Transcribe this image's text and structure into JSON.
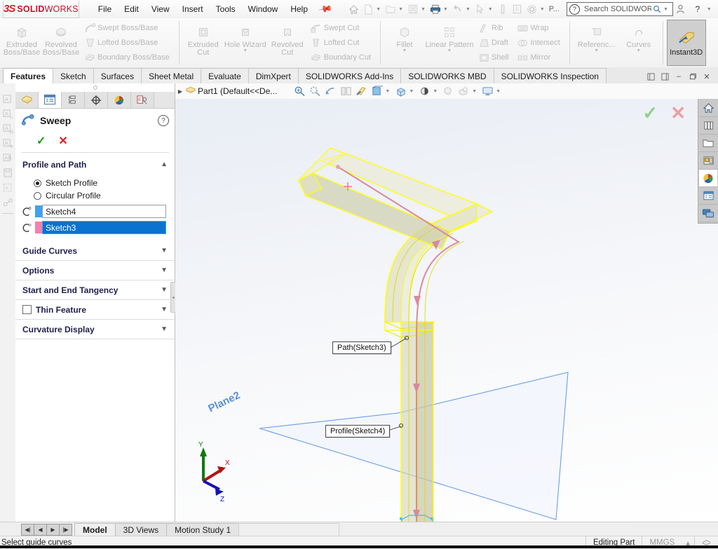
{
  "app": {
    "brand_ds": "ĐS",
    "brand_solid": "SOLID",
    "brand_works": "WORKS",
    "accent_red": "#c8102e",
    "accent_blue": "#0a72cf"
  },
  "menu": {
    "items": [
      "File",
      "Edit",
      "View",
      "Insert",
      "Tools",
      "Window",
      "Help"
    ],
    "pin_icon": "pushpin-icon"
  },
  "quickaccess": {
    "items": [
      {
        "name": "home-icon",
        "glyph": "⌂"
      },
      {
        "name": "new-document-icon",
        "glyph": "⬚"
      },
      {
        "name": "open-document-icon",
        "glyph": "Ὄ2"
      },
      {
        "name": "save-icon",
        "glyph": "Ὃe"
      },
      {
        "name": "print-icon",
        "glyph": "⎙"
      },
      {
        "name": "undo-icon",
        "glyph": "↶"
      },
      {
        "name": "select-icon",
        "glyph": "➤"
      },
      {
        "name": "measure-icon",
        "glyph": "▌"
      },
      {
        "name": "properties-icon",
        "glyph": "☰"
      },
      {
        "name": "options-gear-icon",
        "glyph": "⚙"
      }
    ],
    "overflow_label": "P..."
  },
  "search": {
    "placeholder": "Search SOLIDWORKS Help",
    "value": "Search SOLIDWORKS",
    "help_glyph": "?"
  },
  "window_controls": {
    "account": "὆4",
    "help": "?",
    "minimize": "–",
    "restore": "❐",
    "close": "✕"
  },
  "ribbon": {
    "groups": [
      {
        "name": "boss-base-group",
        "big": [
          {
            "label": "Extruded\nBoss/Base",
            "icon": "extruded-boss-icon"
          },
          {
            "label": "Revolved\nBoss/Base",
            "icon": "revolved-boss-icon"
          }
        ],
        "rows": [
          {
            "label": "Swept Boss/Base",
            "icon": "swept-boss-icon"
          },
          {
            "label": "Lofted Boss/Base",
            "icon": "lofted-boss-icon"
          },
          {
            "label": "Boundary Boss/Base",
            "icon": "boundary-boss-icon"
          }
        ]
      },
      {
        "name": "cut-group",
        "big": [
          {
            "label": "Extruded\nCut",
            "icon": "extruded-cut-icon"
          },
          {
            "label": "Hole Wizard",
            "icon": "hole-wizard-icon"
          },
          {
            "label": "Revolved\nCut",
            "icon": "revolved-cut-icon"
          }
        ],
        "rows": [
          {
            "label": "Swept Cut",
            "icon": "swept-cut-icon"
          },
          {
            "label": "Lofted Cut",
            "icon": "lofted-cut-icon"
          },
          {
            "label": "Boundary Cut",
            "icon": "boundary-cut-icon"
          }
        ]
      },
      {
        "name": "feature-group",
        "big": [
          {
            "label": "Fillet",
            "icon": "fillet-icon"
          },
          {
            "label": "Linear Pattern",
            "icon": "linear-pattern-icon"
          }
        ],
        "rows": [
          {
            "label": "Rib",
            "icon": "rib-icon"
          },
          {
            "label": "Draft",
            "icon": "draft-icon"
          },
          {
            "label": "Shell",
            "icon": "shell-icon"
          }
        ],
        "rows2": [
          {
            "label": "Wrap",
            "icon": "wrap-icon"
          },
          {
            "label": "Intersect",
            "icon": "intersect-icon"
          },
          {
            "label": "Mirror",
            "icon": "mirror-icon"
          }
        ]
      },
      {
        "name": "reference-group",
        "big": [
          {
            "label": "Referenc...",
            "icon": "reference-geometry-icon"
          },
          {
            "label": "Curves",
            "icon": "curves-icon"
          }
        ]
      }
    ],
    "instant3d": {
      "label": "Instant3D",
      "icon": "instant3d-icon",
      "active": true
    }
  },
  "ribbon_tabs": {
    "items": [
      "Features",
      "Sketch",
      "Surfaces",
      "Sheet Metal",
      "Evaluate",
      "DimXpert",
      "SOLIDWORKS Add-Ins",
      "SOLIDWORKS MBD",
      "SOLIDWORKS Inspection"
    ],
    "active": "Features",
    "right_buttons": [
      {
        "name": "collapse-left-icon",
        "glyph": "◧"
      },
      {
        "name": "collapse-right-icon",
        "glyph": "◨"
      },
      {
        "name": "doc-minimize-icon",
        "glyph": "–"
      },
      {
        "name": "doc-restore-icon",
        "glyph": "❐"
      },
      {
        "name": "doc-close-icon",
        "glyph": "✕"
      }
    ]
  },
  "left_strip": {
    "icons": [
      "annotation-note-icon",
      "annotation-balloon-icon",
      "annotation-surface-finish-icon",
      "annotation-weld-icon",
      "annotation-datum-icon",
      "annotation-hole-callout-icon",
      "annotation-block-icon",
      "annotation-centerline-icon"
    ]
  },
  "property_manager": {
    "tabs": [
      {
        "name": "featuremanager-tree-tab",
        "icon": "part-tree-icon",
        "active": false
      },
      {
        "name": "propertymanager-tab",
        "icon": "property-list-icon",
        "active": true
      },
      {
        "name": "configurationmanager-tab",
        "icon": "configuration-icon",
        "active": false
      },
      {
        "name": "dimxpertmanager-tab",
        "icon": "dimxpert-icon",
        "active": false
      },
      {
        "name": "displaymanager-tab",
        "icon": "appearance-ball-icon",
        "active": false
      },
      {
        "name": "addins-tab",
        "icon": "addins-icon",
        "active": false
      }
    ],
    "title": "Sweep",
    "title_icon": "sweep-icon",
    "help_glyph": "?",
    "ok_label": "✓",
    "cancel_label": "✕",
    "sections": {
      "profile_and_path": {
        "label": "Profile and Path",
        "chevron": "⌃",
        "options": [
          {
            "label": "Sketch Profile",
            "selected": true
          },
          {
            "label": "Circular Profile",
            "selected": false
          }
        ],
        "fields": [
          {
            "name": "profile-selection",
            "icon": "profile-icon",
            "swatch": "#3fa2f0",
            "value": "Sketch4",
            "selected": false
          },
          {
            "name": "path-selection",
            "icon": "path-icon",
            "swatch": "#f47fb0",
            "value": "Sketch3",
            "selected": true
          }
        ]
      },
      "collapsed": [
        {
          "label": "Guide Curves",
          "chevron": "⌄",
          "checkbox": false
        },
        {
          "label": "Options",
          "chevron": "⌄",
          "checkbox": false
        },
        {
          "label": "Start and End Tangency",
          "chevron": "⌄",
          "checkbox": false
        },
        {
          "label": "Thin Feature",
          "chevron": "⌄",
          "checkbox": true
        },
        {
          "label": "Curvature Display",
          "chevron": "⌄",
          "checkbox": false
        }
      ]
    }
  },
  "tree_bar": {
    "expand_glyph": "▶",
    "part_icon": "part-icon",
    "label": "Part1  (Default<<De...",
    "view_tools": [
      {
        "name": "zoom-to-fit-icon",
        "glyph": "ὐd"
      },
      {
        "name": "zoom-to-area-icon",
        "glyph": "ὐe"
      },
      {
        "name": "previous-view-icon",
        "glyph": "↩"
      },
      {
        "name": "section-view-icon",
        "glyph": "◫"
      },
      {
        "name": "view-orientation-icon",
        "glyph": "✦"
      },
      {
        "name": "display-style-icon",
        "glyph": "Ὓc",
        "has_dropdown": true
      },
      {
        "name": "hide-show-items-icon",
        "glyph": "⬜",
        "has_dropdown": true
      },
      {
        "name": "edit-appearance-icon",
        "glyph": "◐",
        "has_dropdown": true
      },
      {
        "name": "apply-scene-icon",
        "glyph": "●",
        "has_dropdown": false
      },
      {
        "name": "view-settings-icon",
        "glyph": "☁",
        "has_dropdown": true
      },
      {
        "name": "viewport-icon",
        "glyph": "Ὓ5",
        "has_dropdown": true
      }
    ]
  },
  "graphics": {
    "confirm_ok": "✓",
    "confirm_cancel": "✕",
    "plane_label": "Plane2",
    "callouts": [
      {
        "name": "path-callout",
        "text": "Path(Sketch3)"
      },
      {
        "name": "profile-callout",
        "text": "Profile(Sketch4)"
      }
    ],
    "triad": {
      "x": "X",
      "y": "Y",
      "z": "Z"
    },
    "colors": {
      "preview_yellow": "#ffff00",
      "path_pink": "#e08a9a",
      "plane_blue": "#6b9fe8",
      "plane_fill": "#eaf1fd"
    }
  },
  "task_pane": {
    "items": [
      {
        "name": "task-pane-home-icon",
        "glyph": "⌂",
        "active": false
      },
      {
        "name": "task-pane-design-library-icon",
        "glyph": "Ὅa",
        "active": false
      },
      {
        "name": "task-pane-file-explorer-icon",
        "glyph": "Ὄ1",
        "active": false
      },
      {
        "name": "task-pane-view-palette-icon",
        "glyph": "Ὓc",
        "active": false
      },
      {
        "name": "task-pane-appearances-icon",
        "glyph": "◕",
        "active": true
      },
      {
        "name": "task-pane-custom-properties-icon",
        "glyph": "☰",
        "active": false
      },
      {
        "name": "task-pane-forum-icon",
        "glyph": "὞8",
        "active": false
      }
    ]
  },
  "bottom": {
    "nav_buttons": [
      "◀❙",
      "◀",
      "▶",
      "❙▶"
    ],
    "tabs": [
      {
        "label": "Model",
        "active": true
      },
      {
        "label": "3D Views",
        "active": false
      },
      {
        "label": "Motion Study 1",
        "active": false
      }
    ]
  },
  "status_bar": {
    "message": "Select guide curves",
    "editing": "Editing Part",
    "units": "MMGS",
    "units_caret": "▴",
    "overlay_icon": "overlay-icon"
  }
}
